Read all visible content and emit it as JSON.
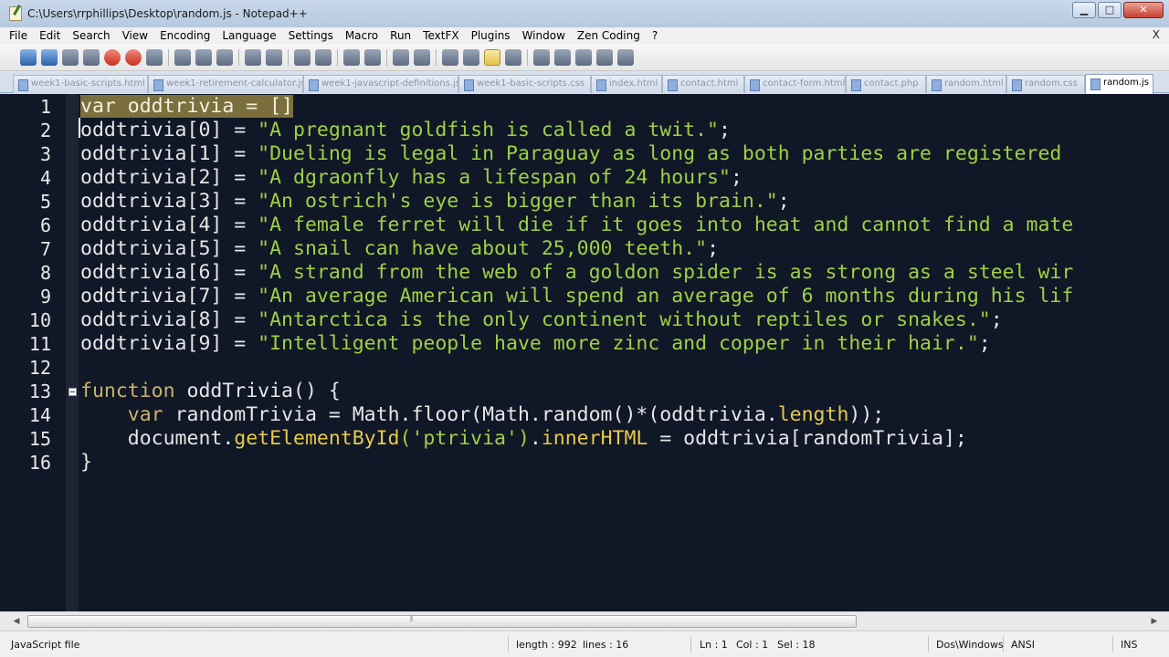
{
  "window": {
    "title": "C:\\Users\\rrphillips\\Desktop\\random.js - Notepad++",
    "minimize": "▁",
    "maximize": "□",
    "close": "✕"
  },
  "menu": {
    "items": [
      "File",
      "Edit",
      "Search",
      "View",
      "Encoding",
      "Language",
      "Settings",
      "Macro",
      "Run",
      "TextFX",
      "Plugins",
      "Window",
      "Zen Coding",
      "?"
    ],
    "close_label": "X"
  },
  "tabs": [
    {
      "label": "week1-basic-scripts.html"
    },
    {
      "label": "week1-retirement-calculator.js"
    },
    {
      "label": "week1-javascript-definitions.js"
    },
    {
      "label": "week1-basic-scripts.css"
    },
    {
      "label": "index.html"
    },
    {
      "label": "contact.html"
    },
    {
      "label": "contact-form.html"
    },
    {
      "label": "contact.php"
    },
    {
      "label": "random.html"
    },
    {
      "label": "random.css"
    },
    {
      "label": "random.js"
    }
  ],
  "editor": {
    "line_numbers": [
      "1",
      "2",
      "3",
      "4",
      "5",
      "6",
      "7",
      "8",
      "9",
      "10",
      "11",
      "12",
      "13",
      "14",
      "15",
      "16"
    ],
    "lines": [
      {
        "prefix_sel": "var oddtrivia = []",
        "rest": ""
      },
      {
        "ident": "oddtrivia[0] = ",
        "str": "\"A pregnant goldfish is called a twit.\"",
        "end": ";"
      },
      {
        "ident": "oddtrivia[1] = ",
        "str": "\"Dueling is legal in Paraguay as long as both parties are registered",
        "end": ""
      },
      {
        "ident": "oddtrivia[2] = ",
        "str": "\"A dgraonfly has a lifespan of 24 hours\"",
        "end": ";"
      },
      {
        "ident": "oddtrivia[3] = ",
        "str": "\"An ostrich's eye is bigger than its brain.\"",
        "end": ";"
      },
      {
        "ident": "oddtrivia[4] = ",
        "str": "\"A female ferret will die if it goes into heat and cannot find a mate",
        "end": ""
      },
      {
        "ident": "oddtrivia[5] = ",
        "str": "\"A snail can have about 25,000 teeth.\"",
        "end": ";"
      },
      {
        "ident": "oddtrivia[6] = ",
        "str": "\"A strand from the web of a goldon spider is as strong as a steel wir",
        "end": ""
      },
      {
        "ident": "oddtrivia[7] = ",
        "str": "\"An average American will spend an average of 6 months during his lif",
        "end": ""
      },
      {
        "ident": "oddtrivia[8] = ",
        "str": "\"Antarctica is the only continent without reptiles or snakes.\"",
        "end": ";"
      },
      {
        "ident": "oddtrivia[9] = ",
        "str": "\"Intelligent people have more zinc and copper in their hair.\"",
        "end": ";"
      },
      {
        "text": ""
      },
      {
        "kw": "function",
        "text": " oddTrivia() {"
      },
      {
        "indent": "    ",
        "kw": "var",
        "a": " randomTrivia = Math.floor(Math.random()*(oddtrivia.",
        "prop": "length",
        "b": "));"
      },
      {
        "indent": "    ",
        "a": "document.",
        "prop": "getElementById",
        "s": "('ptrivia')",
        "c": ".",
        "prop2": "innerHTML",
        "b": " = oddtrivia[randomTrivia];"
      },
      {
        "text": "}"
      }
    ]
  },
  "status": {
    "file_type": "JavaScript file",
    "length": "length : 992",
    "lines": "lines : 16",
    "ln": "Ln : 1",
    "col": "Col : 1",
    "sel": "Sel : 18",
    "eol": "Dos\\Windows",
    "encoding": "ANSI",
    "mode": "INS"
  }
}
